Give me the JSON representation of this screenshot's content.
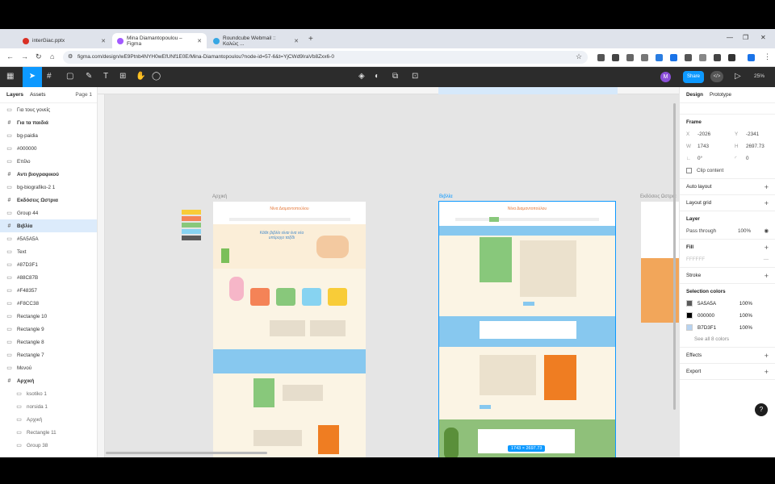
{
  "browser": {
    "tabs": [
      {
        "title": "interGiac.pptx",
        "color": "#d93025"
      },
      {
        "title": "Mina Diamantopoulou – Figma",
        "color": "#a259ff"
      },
      {
        "title": "Roundcube Webmail :: Καλώς ...",
        "color": "#37a7e3"
      }
    ],
    "url": "figma.com/design/wE9Ptnb4NYH0wEfUNf1E0E/Mina-Diamantopoulou?node-id=57-6&t=YjCWd9IraVb8Zxx6-0"
  },
  "toolbar": {
    "share_label": "Share",
    "avatar_letter": "M",
    "zoom": "25%"
  },
  "layers_panel": {
    "tab_layers": "Layers",
    "tab_assets": "Assets",
    "page": "Page 1",
    "items": [
      {
        "label": "Για τους γονείς",
        "bold": false
      },
      {
        "label": "Για τα παιδιά",
        "bold": true
      },
      {
        "label": "bg-paidia",
        "bold": false
      },
      {
        "label": "#000000",
        "bold": false
      },
      {
        "label": "Επίλο",
        "bold": false
      },
      {
        "label": "Αντι βιογραφικού",
        "bold": true
      },
      {
        "label": "bg-biografiko-2 1",
        "bold": false
      },
      {
        "label": "Εκδόσεις Ωστρια",
        "bold": true
      },
      {
        "label": "Group 44",
        "bold": false
      },
      {
        "label": "Βιβλία",
        "bold": true,
        "selected": true
      },
      {
        "label": "#5A5A5A",
        "bold": false
      },
      {
        "label": "Text",
        "bold": false
      },
      {
        "label": "#87D3F1",
        "bold": false
      },
      {
        "label": "#88C87B",
        "bold": false
      },
      {
        "label": "#F48357",
        "bold": false
      },
      {
        "label": "#F8CC38",
        "bold": false
      },
      {
        "label": "Rectangle 10",
        "bold": false
      },
      {
        "label": "Rectangle 9",
        "bold": false
      },
      {
        "label": "Rectangle 8",
        "bold": false
      },
      {
        "label": "Rectangle 7",
        "bold": false
      },
      {
        "label": "Μενού",
        "bold": false
      },
      {
        "label": "Αρχική",
        "bold": true
      },
      {
        "label": "ksotiko 1",
        "bold": false,
        "indent": true
      },
      {
        "label": "norsida 1",
        "bold": false,
        "indent": true
      },
      {
        "label": "Αρχική",
        "bold": false,
        "indent": true
      },
      {
        "label": "Rectangle 11",
        "bold": false,
        "indent": true
      },
      {
        "label": "Group 38",
        "bold": false,
        "indent": true
      }
    ]
  },
  "canvas": {
    "frame_home": "Αρχική",
    "frame_books": "Βιβλία",
    "frame_publishers": "Εκδόσεις Ωστρια",
    "dimensions": "1743 × 2697.73",
    "site_title": "Νίνα Διαμαντοπούλου",
    "hero_text": "Κάθε βιβλίο είναι ένα νέο υπέροχο ταξίδι"
  },
  "design_panel": {
    "tab_design": "Design",
    "tab_prototype": "Prototype",
    "frame_label": "Frame",
    "x": "-2026",
    "y": "-2341",
    "w": "1743",
    "h": "2697.73",
    "rotation": "0°",
    "radius": "0",
    "clip_content": "Clip content",
    "auto_layout": "Auto layout",
    "layout_grid": "Layout grid",
    "layer": "Layer",
    "pass_through": "Pass through",
    "opacity": "100%",
    "fill": "Fill",
    "fill_value": "FFFFFF",
    "stroke": "Stroke",
    "selection_colors": "Selection colors",
    "colors": [
      {
        "hex": "5A5A5A",
        "swatch": "#5A5A5A",
        "pct": "100%"
      },
      {
        "hex": "000000",
        "swatch": "#000000",
        "pct": "100%"
      },
      {
        "hex": "B7D3F1",
        "swatch": "#B7D3F1",
        "pct": "100%"
      }
    ],
    "see_all": "See all 8 colors",
    "effects": "Effects",
    "export": "Export"
  }
}
